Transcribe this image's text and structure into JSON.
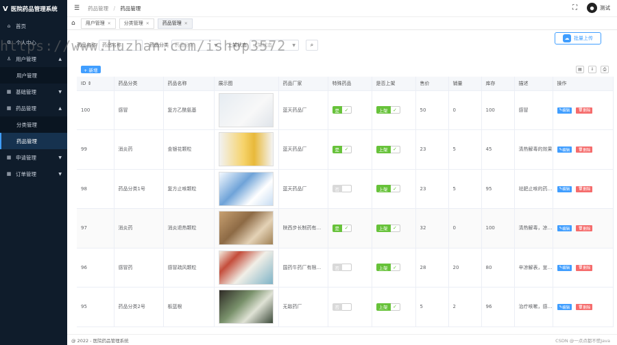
{
  "app": {
    "title": "医院药品管理系统"
  },
  "sidebar": {
    "items": [
      {
        "label": "首页",
        "icon": "home-icon"
      },
      {
        "label": "个人中心",
        "icon": "gear-icon"
      },
      {
        "label": "用户管理",
        "icon": "user-icon",
        "expanded": true
      },
      {
        "label": "用户管理",
        "sub": true
      },
      {
        "label": "基础管理",
        "icon": "grid-icon"
      },
      {
        "label": "药品管理",
        "icon": "grid-icon",
        "expanded": true
      },
      {
        "label": "分类管理",
        "sub": true
      },
      {
        "label": "药品管理",
        "sub": true,
        "active": true
      },
      {
        "label": "申请管理",
        "icon": "grid-icon"
      },
      {
        "label": "订单管理",
        "icon": "grid-icon"
      }
    ]
  },
  "header": {
    "breadcrumb": [
      "药品管理",
      "药品管理"
    ],
    "username": "测试"
  },
  "tags": [
    {
      "label": "用户管理"
    },
    {
      "label": "分类管理"
    },
    {
      "label": "药品管理",
      "active": true
    }
  ],
  "search": {
    "name_label": "药品名称",
    "name_placeholder": "药品名称",
    "category_label": "药品分类",
    "category_placeholder": "药品分类",
    "status_label": "上架状态",
    "status_placeholder": "上架状态"
  },
  "upload_label": "批量上传",
  "add_label": "+ 新增",
  "table": {
    "headers": [
      "ID",
      "药品分类",
      "药品名称",
      "展示图",
      "药品厂家",
      "特殊药品",
      "是否上架",
      "售价",
      "销量",
      "库存",
      "描述",
      "操作"
    ],
    "rows": [
      {
        "id": "100",
        "category": "感冒",
        "name": "复方乙酰氨基",
        "maker": "蓝天药品厂",
        "special": "是",
        "special_on": true,
        "shelf": "上架",
        "price": "50",
        "sales": "0",
        "stock": "100",
        "desc": "感冒"
      },
      {
        "id": "99",
        "category": "消炎药",
        "name": "金银花颗粒",
        "maker": "蓝天药品厂",
        "special": "是",
        "special_on": true,
        "shelf": "上架",
        "price": "23",
        "sales": "5",
        "stock": "45",
        "desc": "清热解毒的效果"
      },
      {
        "id": "98",
        "category": "药品分类1号",
        "name": "复方止咳颗粒",
        "maker": "蓝天药品厂",
        "special": "否",
        "special_on": false,
        "shelf": "上架",
        "price": "23",
        "sales": "5",
        "stock": "95",
        "desc": "祛肥止咳的药效好"
      },
      {
        "id": "97",
        "category": "消炎药",
        "name": "消炎退热颗粒",
        "maker": "陕西步长制药有...",
        "special": "是",
        "special_on": true,
        "shelf": "上架",
        "price": "32",
        "sales": "0",
        "stock": "100",
        "desc": "清热解毒，凉血消"
      },
      {
        "id": "96",
        "category": "感冒药",
        "name": "感冒疏风颗粒",
        "maker": "国药牛药厂有限...",
        "special": "否",
        "special_on": false,
        "shelf": "上架",
        "price": "28",
        "sales": "20",
        "stock": "80",
        "desc": "辛凉解表，宣肺利"
      },
      {
        "id": "95",
        "category": "药品分类2号",
        "name": "板蓝根",
        "maker": "无敌药厂",
        "special": "否",
        "special_on": false,
        "shelf": "上架",
        "price": "5",
        "sales": "2",
        "stock": "96",
        "desc": "治疗咳嗽，感冒等"
      }
    ],
    "edit_label": "编辑",
    "delete_label": "删除"
  },
  "footer": {
    "copyright": "@ 2022 - 医院药品管理系统",
    "credit": "CSDN @一点点都不慌Java"
  },
  "watermark": "https://www.huzhan.com/ishop3572",
  "colors": {
    "primary": "#409eff",
    "success": "#67c23a",
    "danger": "#f56c6c",
    "sidebar": "#0f1c2b"
  }
}
